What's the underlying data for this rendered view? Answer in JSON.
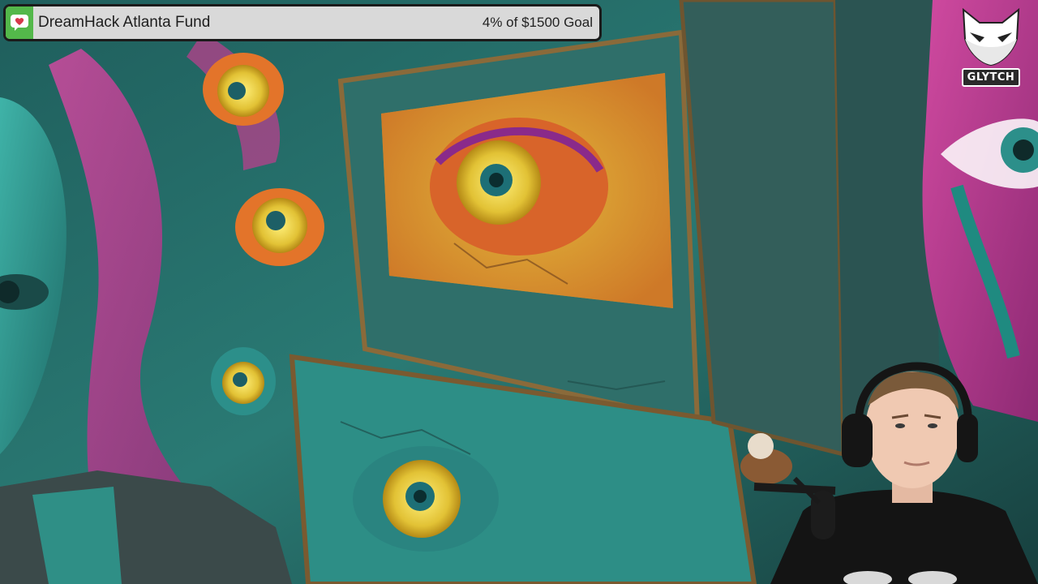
{
  "goal": {
    "title": "DreamHack Atlanta Fund",
    "progress_text": "4% of $1500 Goal",
    "progress_fraction": 0.04,
    "icon": "heart-chat-icon",
    "fill_color": "#53b84a",
    "bar_color": "#d9d9d9"
  },
  "brand": {
    "name": "GLYTCH",
    "icon": "fox-logo-icon"
  },
  "scene": {
    "description_icon": "painted-eyes-wall",
    "colors": {
      "teal": "#2c8f8a",
      "magenta": "#c23d8f",
      "yellow": "#e5c63a",
      "orange": "#e3742a"
    }
  },
  "webcam": {
    "icon": "streamer-webcam"
  }
}
